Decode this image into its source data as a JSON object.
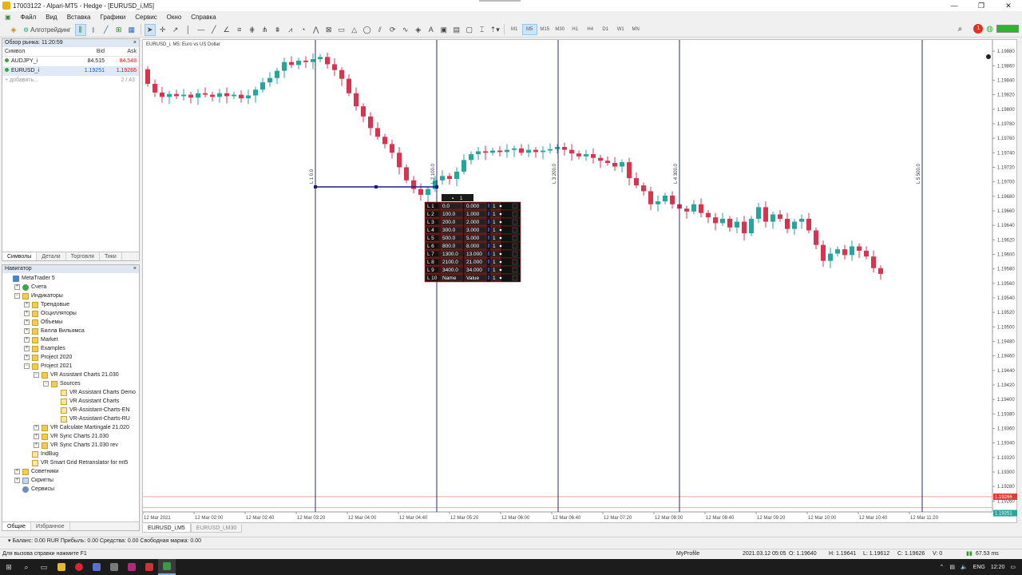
{
  "window": {
    "title": "17003122 - Alpari-MT5 - Hedge - [EURUSD_i,M5]",
    "controls": [
      "—",
      "❐",
      "✕"
    ]
  },
  "menu": [
    "Файл",
    "Вид",
    "Вставка",
    "Графики",
    "Сервис",
    "Окно",
    "Справка"
  ],
  "toolbar": {
    "algo_label": "Алготрейдинг",
    "timeframes": [
      "M1",
      "M5",
      "M15",
      "M30",
      "H1",
      "H4",
      "D1",
      "W1",
      "MN"
    ],
    "active_timeframe": "M5",
    "notification_count": "1"
  },
  "market_watch": {
    "title": "Обзор рынка: 11:20:59",
    "columns": [
      "Символ",
      "Bid",
      "Ask"
    ],
    "rows": [
      {
        "symbol": "AUDJPY_i",
        "bid": "84.515",
        "ask": "84.548"
      },
      {
        "symbol": "EURUSD_i",
        "bid": "1.19251",
        "ask": "1.19266"
      }
    ],
    "add_label": "добавить...",
    "count": "2 / 43",
    "tabs": [
      "Символы",
      "Детали",
      "Торговля",
      "Тики"
    ]
  },
  "navigator": {
    "title": "Навигатор",
    "items": [
      {
        "label": "MetaTrader 5",
        "indent": 0,
        "icon": "mt",
        "exp": ""
      },
      {
        "label": "Счета",
        "indent": 1,
        "icon": "acc",
        "exp": "+"
      },
      {
        "label": "Индикаторы",
        "indent": 1,
        "icon": "folder",
        "exp": "−"
      },
      {
        "label": "Трендовые",
        "indent": 2,
        "icon": "folder",
        "exp": "+"
      },
      {
        "label": "Осцилляторы",
        "indent": 2,
        "icon": "folder",
        "exp": "+"
      },
      {
        "label": "Объемы",
        "indent": 2,
        "icon": "folder",
        "exp": "+"
      },
      {
        "label": "Билла Вильямса",
        "indent": 2,
        "icon": "folder",
        "exp": "+"
      },
      {
        "label": "Market",
        "indent": 2,
        "icon": "folder",
        "exp": "+"
      },
      {
        "label": "Examples",
        "indent": 2,
        "icon": "folder",
        "exp": "+"
      },
      {
        "label": "Project 2020",
        "indent": 2,
        "icon": "folder",
        "exp": "+"
      },
      {
        "label": "Project 2021",
        "indent": 2,
        "icon": "folder",
        "exp": "−"
      },
      {
        "label": "VR Assistant Charts 21.030",
        "indent": 3,
        "icon": "folder",
        "exp": "−"
      },
      {
        "label": "Sources",
        "indent": 4,
        "icon": "folder",
        "exp": "−"
      },
      {
        "label": "VR Assistant Charts Demo",
        "indent": 5,
        "icon": "ind",
        "exp": ""
      },
      {
        "label": "VR Assistant Charts",
        "indent": 5,
        "icon": "ind",
        "exp": ""
      },
      {
        "label": "VR-Assistant-Charts-EN",
        "indent": 5,
        "icon": "ind",
        "exp": ""
      },
      {
        "label": "VR-Assistant-Charts-RU",
        "indent": 5,
        "icon": "ind",
        "exp": ""
      },
      {
        "label": "VR Calculate Martingale 21.020",
        "indent": 3,
        "icon": "folder",
        "exp": "+"
      },
      {
        "label": "VR Sync Charts 21.030",
        "indent": 3,
        "icon": "folder",
        "exp": "+"
      },
      {
        "label": "VR Sync Charts 21.030 rev",
        "indent": 3,
        "icon": "folder",
        "exp": "+"
      },
      {
        "label": "IndBug",
        "indent": 2,
        "icon": "ind",
        "exp": ""
      },
      {
        "label": "VR Smart Grid Retranslator for mt5",
        "indent": 2,
        "icon": "ind",
        "exp": ""
      },
      {
        "label": "Советники",
        "indent": 1,
        "icon": "folder",
        "exp": "+"
      },
      {
        "label": "Скрипты",
        "indent": 1,
        "icon": "script",
        "exp": "+"
      },
      {
        "label": "Сервисы",
        "indent": 1,
        "icon": "serv",
        "exp": ""
      }
    ],
    "tabs": [
      "Общие",
      "Избранное"
    ]
  },
  "chart": {
    "label": "EURUSD_i, M5:  Euro vs US Dollar",
    "price_labels": [
      "1.19880",
      "1.19860",
      "1.19840",
      "1.19820",
      "1.19800",
      "1.19780",
      "1.19760",
      "1.19740",
      "1.19720",
      "1.19700",
      "1.19680",
      "1.19660",
      "1.19640",
      "1.19620",
      "1.19600",
      "1.19580",
      "1.19560",
      "1.19540",
      "1.19520",
      "1.19500",
      "1.19480",
      "1.19460",
      "1.19440",
      "1.19420",
      "1.19400",
      "1.19380",
      "1.19360",
      "1.19340",
      "1.19320",
      "1.19300",
      "1.19280",
      "1.19260"
    ],
    "time_labels": [
      "12 Mar 2021",
      "12 Mar 02:00",
      "12 Mar 02:40",
      "12 Mar 03:20",
      "12 Mar 04:00",
      "12 Mar 04:40",
      "12 Mar 05:20",
      "12 Mar 06:00",
      "12 Mar 06:40",
      "12 Mar 07:20",
      "12 Mar 08:00",
      "12 Mar 08:40",
      "12 Mar 09:20",
      "12 Mar 10:00",
      "12 Mar 10:40",
      "12 Mar 11:20"
    ],
    "ask_label": "1.19266",
    "bid_label": "1.19251",
    "vlines": [
      "L 1 0.0",
      "L 2 100.0",
      "L 3 200.0",
      "L 4 300.0",
      "L 5 500.0"
    ],
    "colors": {
      "up": "#26a69a",
      "down": "#d8344f",
      "level": "#2a2a6e"
    }
  },
  "fib_panel": {
    "header": [
      "▪",
      "1"
    ],
    "rows": [
      [
        "L 1",
        "0.0",
        "0.000",
        "1"
      ],
      [
        "L 2",
        "100.0",
        "1.000",
        "1"
      ],
      [
        "L 3",
        "200.0",
        "2.000",
        "1"
      ],
      [
        "L 4",
        "300.0",
        "3.000",
        "1"
      ],
      [
        "L 5",
        "500.0",
        "5.000",
        "1"
      ],
      [
        "L 6",
        "800.0",
        "8.000",
        "1"
      ],
      [
        "L 7",
        "1300.0",
        "13.000",
        "1"
      ],
      [
        "L 8",
        "2100.0",
        "21.000",
        "1"
      ],
      [
        "L 9",
        "3400.0",
        "34.000",
        "1"
      ],
      [
        "L 10",
        "Name",
        "Value",
        "1"
      ]
    ]
  },
  "chart_tabs": [
    "EURUSD_i,M5",
    "EURUSD_i,M30"
  ],
  "status_bar": {
    "balance": "Баланс: 0.00 RUR  Прибыль: 0.00  Средства: 0.00  Свободная маржа: 0.00",
    "help": "Для вызова справки нажмите F1",
    "profile": "MyProfile",
    "datetime": "2021.03.12 05:05",
    "open": "O: 1.19640",
    "high": "H: 1.19641",
    "low": "L: 1.19612",
    "close": "C: 1.19626",
    "volume": "V: 0",
    "ping": "67.53 ms"
  },
  "taskbar": {
    "lang": "ENG",
    "time": "12:20"
  }
}
